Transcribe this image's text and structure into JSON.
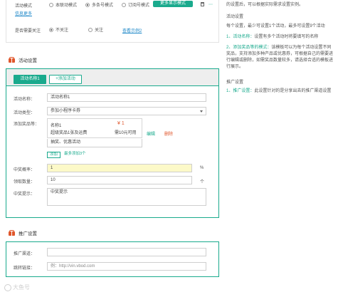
{
  "top": {
    "mode_label": "活动模式",
    "mode_options": [
      "本联动模式",
      "多条号模式",
      "订阅号模式"
    ],
    "mode_selected": 1,
    "more_tab": "更多显示模式",
    "mode_link": "信息更多",
    "follow_label": "是否需要关注",
    "follow_options": [
      "不关注",
      "关注"
    ],
    "follow_selected": 0,
    "follow_link": "查看示例2"
  },
  "section_event": {
    "title": "活动设置",
    "tabs": [
      "活动名称1",
      "+添加活动"
    ],
    "name_label": "活动名称：",
    "name_value": "活动名称1",
    "type_label": "活动类型：",
    "type_value": "参加小程序卡券",
    "prize_label": "添加奖品等：",
    "product": {
      "title": "名称1",
      "sub": "超级奖品1张及运费",
      "price": "¥ 1",
      "price_note": "需10元可用",
      "edit": "编辑",
      "delete": "删除"
    },
    "prize_tip": "抽奖、优惠活动",
    "mini_buttons": [
      "添加",
      "最多添加3个"
    ],
    "rate_label": "中奖概率：",
    "rate_value": "1",
    "rate_unit": "%",
    "limit_label": "领取数量：",
    "limit_value": "10",
    "limit_unit": "个",
    "tips_label": "中奖提示：",
    "tips_value": "中奖提示"
  },
  "section_promo": {
    "title": "推广设置",
    "promo_label": "推广渠道：",
    "promo_value": "",
    "link_label": "跳转链接：",
    "link_placeholder": "例：http://vin.vbod.com"
  },
  "right": {
    "intro": "的设置后，可以根据实际需求设置实例。",
    "sec1_title": "活动设置",
    "sec1_body": "每个设置，最少可设置1个活动，最多可设置9个活动",
    "item1_key": "1、活动名称：",
    "item1_body": "设置有多个活动时将要填写的名称",
    "item2_key": "2、添加奖品等的模式：",
    "item2_body": "该模板可以为每个活动设置不同奖品，支持添加多种产品或优惠券，可根据自己的需要进行编辑或删除，如需奖品数量较多，请选择合适的模板进行展示。",
    "sec2_title": "推广设置",
    "item3_key": "1、推广设置：",
    "item3_body": "此设置针对的是分享出去的推广渠道设置"
  },
  "watermark": "大鱼号",
  "colors": {
    "accent": "#1aaa8d",
    "brand_orange": "#e0572c",
    "highlight_input": "#fcf9c8"
  }
}
